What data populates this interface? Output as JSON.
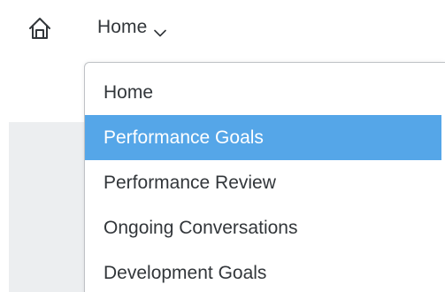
{
  "nav": {
    "current_label": "Home",
    "home_icon": "home-icon",
    "chevron_icon": "chevron-down-icon"
  },
  "menu": {
    "items": [
      {
        "label": "Home",
        "selected": false
      },
      {
        "label": "Performance Goals",
        "selected": true
      },
      {
        "label": "Performance Review",
        "selected": false
      },
      {
        "label": "Ongoing Conversations",
        "selected": false
      },
      {
        "label": "Development Goals",
        "selected": false
      }
    ]
  },
  "colors": {
    "highlight": "#55a6e8",
    "text": "#32363a",
    "background_panel": "#eceef0"
  }
}
